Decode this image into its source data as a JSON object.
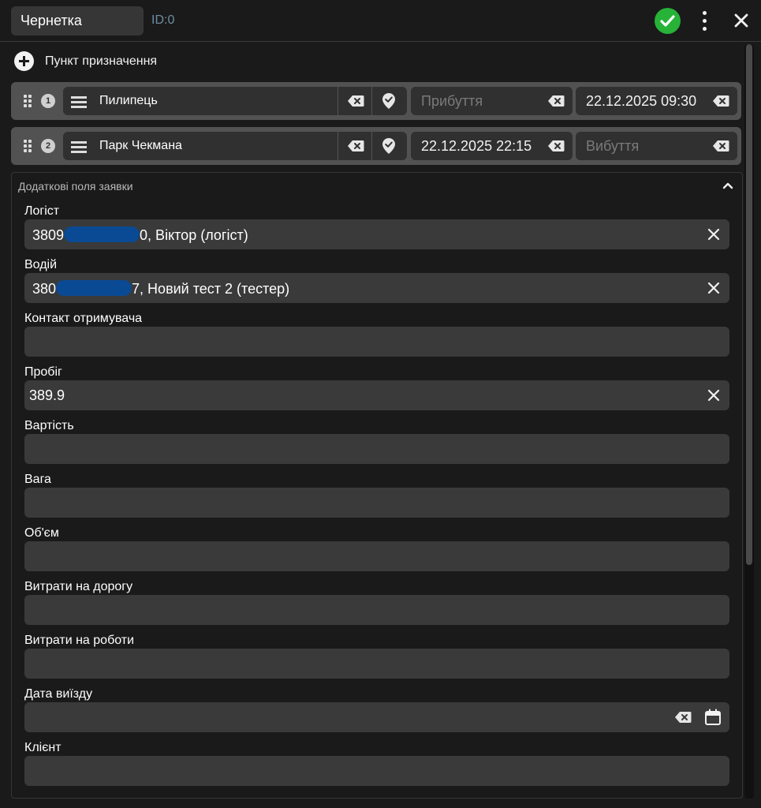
{
  "header": {
    "status": "Чернетка",
    "id_label": "ID:0"
  },
  "add_destination": "Пункт призначення",
  "route_points": [
    {
      "index": "1",
      "place": "Пилипець",
      "arrival": "",
      "arrival_placeholder": "Прибуття",
      "departure": "22.12.2025 09:30",
      "departure_placeholder": "Вибуття"
    },
    {
      "index": "2",
      "place": "Парк Чекмана",
      "arrival": "22.12.2025 22:15",
      "arrival_placeholder": "Прибуття",
      "departure": "",
      "departure_placeholder": "Вибуття"
    }
  ],
  "extra_fields": {
    "title": "Додаткові поля заявки",
    "logist": {
      "label": "Логіст",
      "value_prefix": "3809",
      "value_suffix": "0, Віктор (логіст)"
    },
    "driver": {
      "label": "Водій",
      "value_prefix": "380",
      "value_suffix": "7, Новий тест 2 (тестер)"
    },
    "recipient_contact": {
      "label": "Контакт отримувача",
      "value": ""
    },
    "mileage": {
      "label": "Пробіг",
      "value": "389.9"
    },
    "cost": {
      "label": "Вартість",
      "value": ""
    },
    "weight": {
      "label": "Вага",
      "value": ""
    },
    "volume": {
      "label": "Об'єм",
      "value": ""
    },
    "road_costs": {
      "label": "Витрати на дорогу",
      "value": ""
    },
    "work_costs": {
      "label": "Витрати на роботи",
      "value": ""
    },
    "departure_date": {
      "label": "Дата виїзду",
      "value": ""
    },
    "client": {
      "label": "Клієнт",
      "value": ""
    }
  },
  "colors": {
    "accent_check": "#27b238",
    "id_text": "#6f8da3",
    "redaction": "#0a4a94"
  },
  "icons": [
    "check-icon",
    "kebab-icon",
    "close-icon",
    "plus-circle-icon",
    "drag-handle-icon",
    "menu-icon",
    "backspace-icon",
    "map-pin-check-icon",
    "chevron-up-icon",
    "calendar-icon"
  ]
}
